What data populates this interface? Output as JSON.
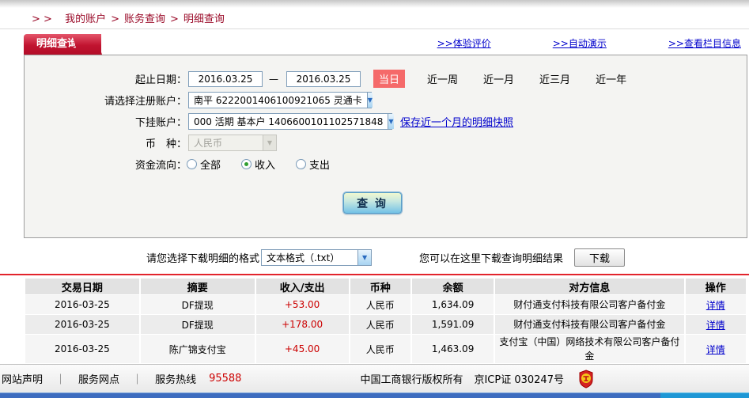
{
  "breadcrumb": {
    "prefix": "> >",
    "items": [
      "我的账户",
      "账务查询",
      "明细查询"
    ],
    "separator": ">"
  },
  "tab": {
    "label": "明细查询"
  },
  "top_links": [
    ">>体验评价",
    ">>自动演示",
    ">>查看栏目信息"
  ],
  "form": {
    "date_label": "起止日期：",
    "date_from": "2016.03.25",
    "date_to": "2016.03.25",
    "date_separator": "—",
    "quick_today": "当日",
    "quick_ranges": [
      "近一周",
      "近一月",
      "近三月",
      "近一年"
    ],
    "account_label": "请选择注册账户：",
    "account_value": "南平  6222001406100921065  灵通卡",
    "sub_account_label": "下挂账户：",
    "sub_account_value": "000 活期 基本户 1406600101102571848",
    "snapshot_link": "保存近一个月的明细快照",
    "currency_label": "币　种：",
    "currency_value": "人民币",
    "flow_label": "资金流向：",
    "flow_options": [
      {
        "label": "全部",
        "checked": false
      },
      {
        "label": "收入",
        "checked": true
      },
      {
        "label": "支出",
        "checked": false
      }
    ],
    "query_button": "查 询"
  },
  "download": {
    "format_label": "请您选择下载明细的格式",
    "format_value": "文本格式（.txt）",
    "hint": "您可以在这里下载查询明细结果",
    "button": "下载"
  },
  "table": {
    "headers": [
      "交易日期",
      "摘要",
      "收入/支出",
      "币种",
      "余额",
      "对方信息",
      "操作"
    ],
    "rows": [
      {
        "date": "2016-03-25",
        "summary": "DF提现",
        "amount": "+53.00",
        "currency": "人民币",
        "balance": "1,634.09",
        "counterparty": "财付通支付科技有限公司客户备付金",
        "action": "详情"
      },
      {
        "date": "2016-03-25",
        "summary": "DF提现",
        "amount": "+178.00",
        "currency": "人民币",
        "balance": "1,591.09",
        "counterparty": "财付通支付科技有限公司客户备付金",
        "action": "详情"
      },
      {
        "date": "2016-03-25",
        "summary": "陈广锦支付宝",
        "amount": "+45.00",
        "currency": "人民币",
        "balance": "1,463.09",
        "counterparty": "支付宝（中国）网络技术有限公司客户备付金",
        "action": "详情"
      }
    ]
  },
  "footer": {
    "links": [
      "网站声明",
      "服务网点"
    ],
    "hotline_label": "服务热线",
    "hotline_number": "95588",
    "copyright": "中国工商银行版权所有",
    "icp": "京ICP证 030247号",
    "badge_icon": "icp-license-badge"
  },
  "colors": {
    "brand_red": "#c11430",
    "breadcrumb_red": "#9b0c2a",
    "link_blue": "#0000cc",
    "amount_red": "#cc0000",
    "today_badge_bg": "#f56a6a",
    "hotline_red": "#cc0000",
    "bottom_bar_left": "#3d6cbf",
    "bottom_bar_right": "#1e97d5"
  }
}
